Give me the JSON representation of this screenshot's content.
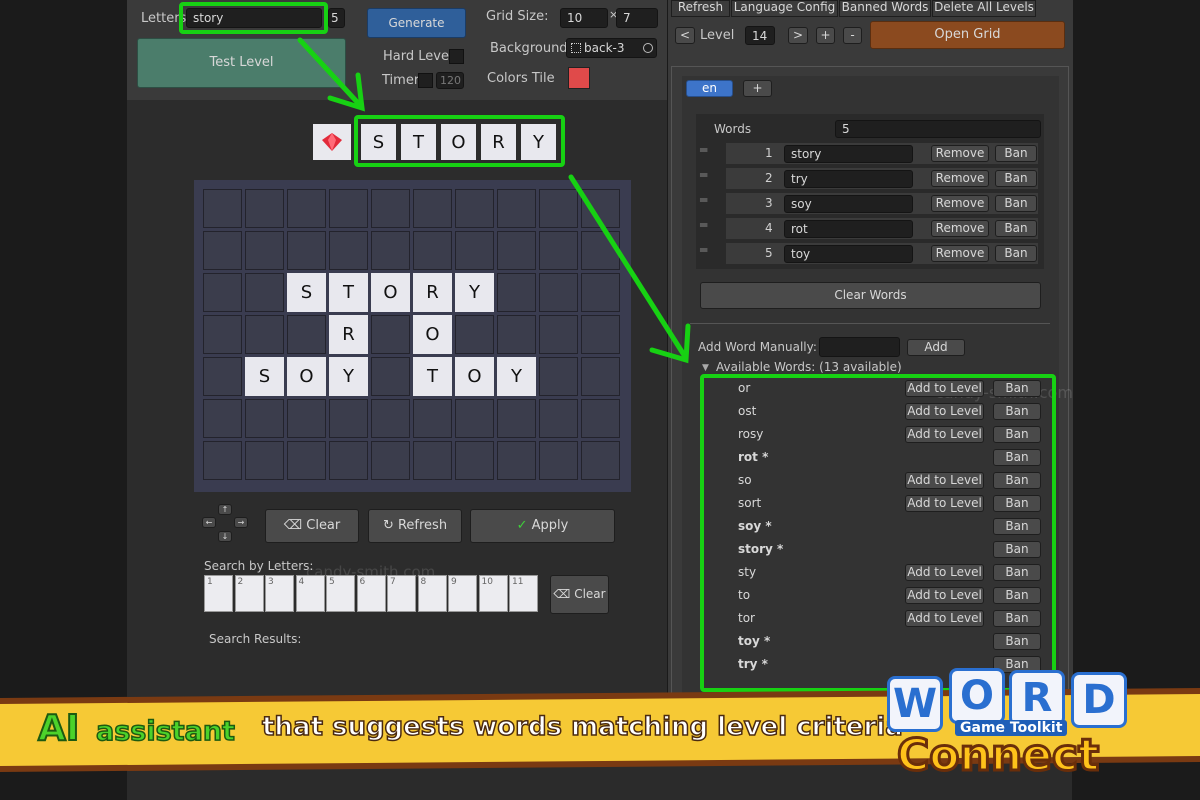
{
  "left": {
    "letters_label": "Letters",
    "letters_value": "story",
    "letters_count": "5",
    "generate_label": "Generate",
    "test_level_label": "Test Level",
    "hard_level_label": "Hard Level",
    "timer_label": "Timer",
    "timer_value": "120",
    "grid_size_label": "Grid Size:",
    "grid_w": "10",
    "grid_x": "×",
    "grid_h": "7",
    "background_label": "Background:",
    "background_value": "back-3",
    "colors_tile_label": "Colors Tile",
    "tile_color": "#e04a4a",
    "preview_letters": [
      "S",
      "T",
      "O",
      "R",
      "Y"
    ],
    "grid_letters": [
      {
        "r": 2,
        "c": 2,
        "t": "S"
      },
      {
        "r": 2,
        "c": 3,
        "t": "T"
      },
      {
        "r": 2,
        "c": 4,
        "t": "O"
      },
      {
        "r": 2,
        "c": 5,
        "t": "R"
      },
      {
        "r": 2,
        "c": 6,
        "t": "Y"
      },
      {
        "r": 3,
        "c": 3,
        "t": "R"
      },
      {
        "r": 3,
        "c": 5,
        "t": "O"
      },
      {
        "r": 4,
        "c": 1,
        "t": "S"
      },
      {
        "r": 4,
        "c": 2,
        "t": "O"
      },
      {
        "r": 4,
        "c": 3,
        "t": "Y"
      },
      {
        "r": 4,
        "c": 5,
        "t": "T"
      },
      {
        "r": 4,
        "c": 6,
        "t": "O"
      },
      {
        "r": 4,
        "c": 7,
        "t": "Y"
      }
    ],
    "clear_label": "Clear",
    "refresh_label": "Refresh",
    "apply_label": "Apply",
    "search_letters_label": "Search by Letters:",
    "search_slots": [
      "1",
      "2",
      "3",
      "4",
      "5",
      "6",
      "7",
      "8",
      "9",
      "10",
      "11"
    ],
    "search_clear_label": "Clear",
    "search_results_label": "Search Results:",
    "watermark": "candy-smith.com"
  },
  "right": {
    "tabs": [
      "Refresh",
      "Language Config",
      "Banned Words",
      "Delete All Levels"
    ],
    "prev_label": "<",
    "level_label": "Level",
    "level_value": "14",
    "next_label": ">",
    "plus_label": "+",
    "minus_label": "-",
    "open_grid_label": "Open Grid",
    "lang_tab": "en",
    "lang_add": "+",
    "words_label": "Words",
    "words_count": "5",
    "words": [
      {
        "n": "1",
        "w": "story"
      },
      {
        "n": "2",
        "w": "try"
      },
      {
        "n": "3",
        "w": "soy"
      },
      {
        "n": "4",
        "w": "rot"
      },
      {
        "n": "5",
        "w": "toy"
      }
    ],
    "remove_label": "Remove",
    "ban_label": "Ban",
    "clear_words_label": "Clear Words",
    "add_manual_label": "Add Word Manually:",
    "add_label": "Add",
    "available_label": "Available Words: (13 available)",
    "add_to_level_label": "Add to Level",
    "available": [
      {
        "w": "or",
        "b": false
      },
      {
        "w": "ost",
        "b": false
      },
      {
        "w": "rosy",
        "b": false
      },
      {
        "w": "rot *",
        "b": true
      },
      {
        "w": "so",
        "b": false
      },
      {
        "w": "sort",
        "b": false
      },
      {
        "w": "soy *",
        "b": true
      },
      {
        "w": "story *",
        "b": true
      },
      {
        "w": "sty",
        "b": false
      },
      {
        "w": "to",
        "b": false
      },
      {
        "w": "tor",
        "b": false
      },
      {
        "w": "toy *",
        "b": true
      },
      {
        "w": "try *",
        "b": true
      }
    ],
    "watermark": "candy-smith.com"
  },
  "banner": {
    "ai": "AI",
    "assistant": "assistant",
    "tagline": "that suggests words matching level criteria",
    "logo_letters": [
      "W",
      "O",
      "R",
      "D"
    ],
    "logo_sub": "Game Toolkit",
    "logo_main": "Connect"
  },
  "colors": {
    "accent_green": "#17d113",
    "banner_yellow": "#f6c935",
    "open_grid": "#8b4a1f"
  }
}
